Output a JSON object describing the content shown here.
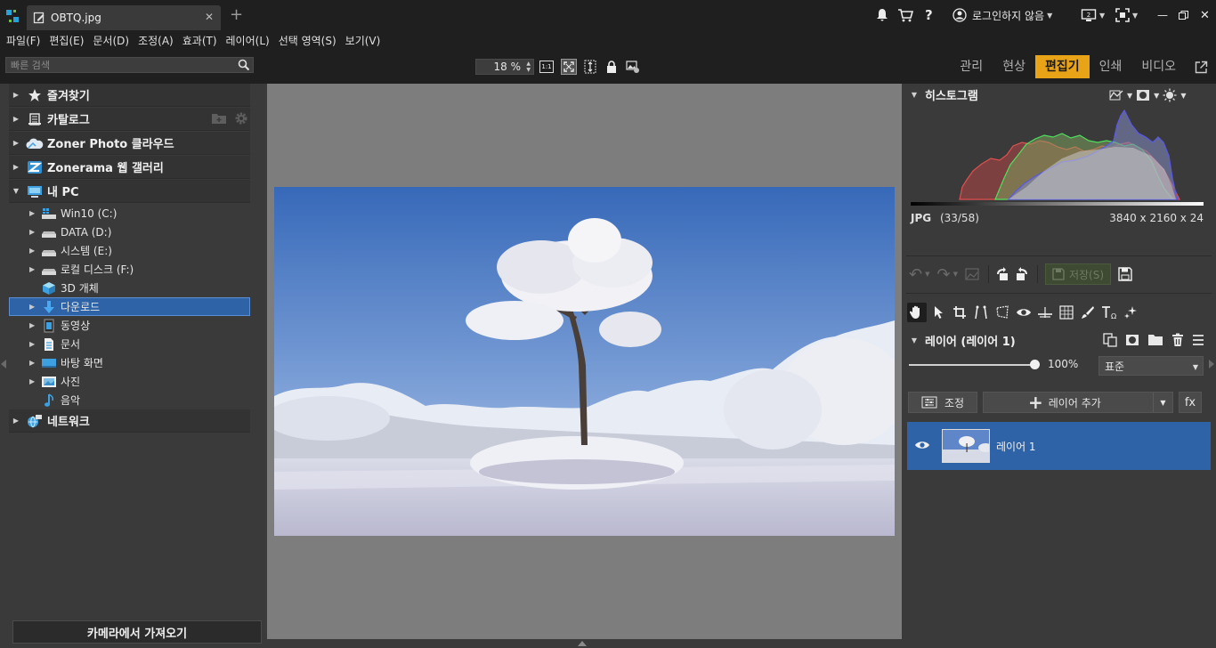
{
  "titlebar": {
    "tab_title": "OBTQ.jpg",
    "login_label": "로그인하지 않음"
  },
  "menu": [
    "파일(F)",
    "편집(E)",
    "문서(D)",
    "조정(A)",
    "효과(T)",
    "레이어(L)",
    "선택 영역(S)",
    "보기(V)"
  ],
  "toolbar": {
    "search_placeholder": "빠른 검색",
    "zoom_value": "18 %",
    "zoom_1to1": "1:1"
  },
  "modules": [
    "관리",
    "현상",
    "편집기",
    "인쇄",
    "비디오"
  ],
  "active_module": "편집기",
  "left_panel": {
    "sections": {
      "favorites": "즐겨찾기",
      "catalog": "카탈로그",
      "cloud": "Zoner Photo 클라우드",
      "zonerama": "Zonerama 웹 갤러리",
      "my_pc": "내 PC",
      "network": "네트워크"
    },
    "tree": [
      "Win10 (C:)",
      "DATA (D:)",
      "시스템 (E:)",
      "로컬 디스크 (F:)",
      "3D 개체",
      "다운로드",
      "동영상",
      "문서",
      "바탕 화면",
      "사진",
      "음악"
    ],
    "selected_item": "다운로드",
    "import_button": "카메라에서 가져오기"
  },
  "right_panel": {
    "histogram_title": "히스토그램",
    "file_format": "JPG",
    "file_index": "(33/58)",
    "dimensions": "3840 x 2160 x 24",
    "save_label": "저장(S)",
    "layers_title": "레이어 (레이어 1)",
    "opacity": "100%",
    "opacity_value": 1.0,
    "blend_mode": "표준",
    "adjust_label": "조정",
    "add_layer_label": "레이어 추가",
    "fx_label": "fx",
    "layer_name": "레이어 1"
  },
  "colors": {
    "accent": "#e8a317",
    "selection": "#2e63a8",
    "dark_bar": "#1f1f1f",
    "panel": "#3a3a3a",
    "canvas": "#7d7d7d"
  }
}
